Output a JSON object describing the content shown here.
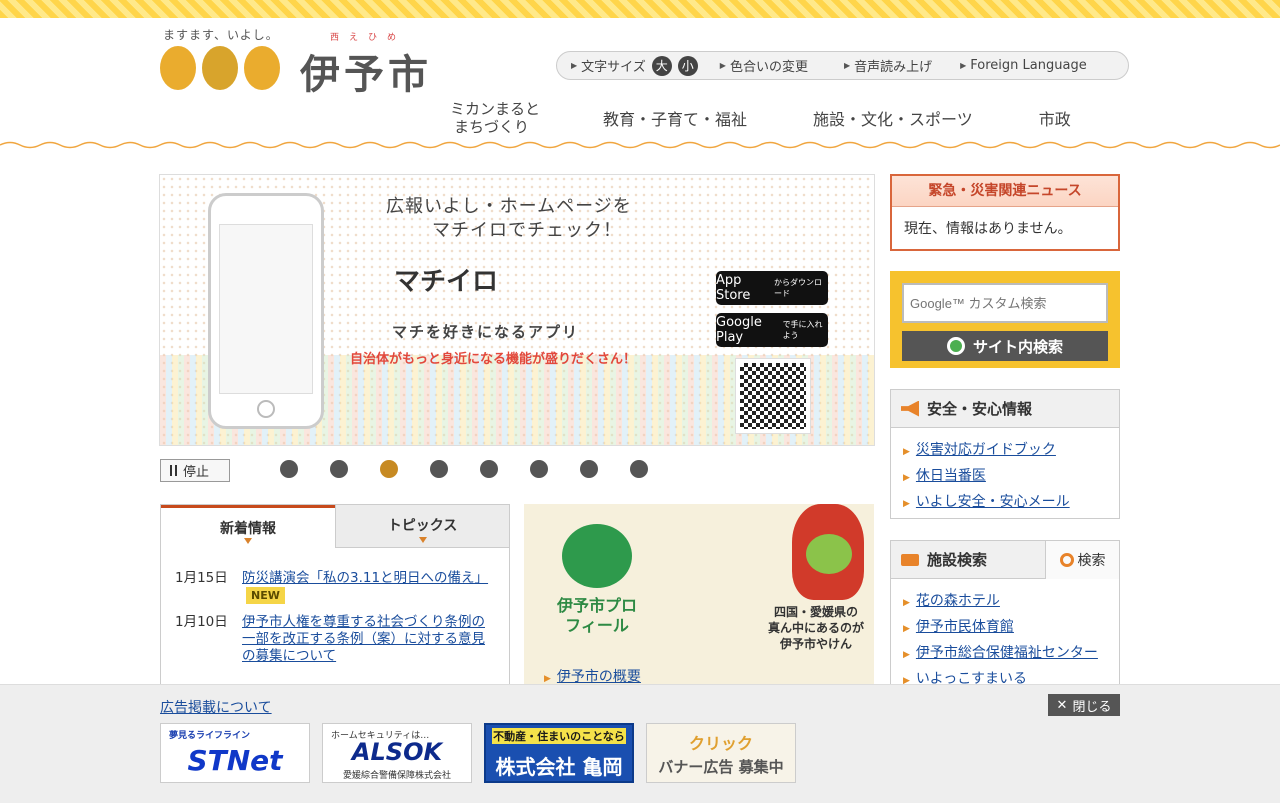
{
  "header": {
    "tagline": "ますます、いよし。",
    "logo_title": "伊予市",
    "logo_ruby": "西えひめ",
    "util": {
      "font_size_label": "文字サイズ",
      "font_large": "大",
      "font_small": "小",
      "color_change": "色合いの変更",
      "read_aloud": "音声読み上げ",
      "foreign_language": "Foreign Language"
    },
    "nav": {
      "item1_line1": "ミカンまると",
      "item1_line2": "まちづくり",
      "item2": "教育・子育て・福祉",
      "item3": "施設・文化・スポーツ",
      "item4": "市政"
    }
  },
  "slider": {
    "headline_line1": "広報いよし・ホームページを",
    "headline_line2": "マチイロでチェック！",
    "brand": "マチイロ",
    "tagline": "マチを好きになるアプリ",
    "subline": "自治体がもっと身近になる機能が盛りだくさん！",
    "app_store_label": "App Store",
    "app_store_sub": "からダウンロード",
    "google_play_label": "Google Play",
    "google_play_sub": "で手に入れよう",
    "pause_label": "停止",
    "page_count": 8,
    "active_page": 3
  },
  "news": {
    "tab_new": "新着情報",
    "tab_topics": "トピックス",
    "items": [
      {
        "date": "1月15日",
        "title": "防災講演会「私の3.11と明日への備え」",
        "badge": "NEW"
      },
      {
        "date": "1月10日",
        "title": "伊予市人権を尊重する社会づくり条例の一部を改正する条例（案）に対する意見の募集について",
        "badge": ""
      }
    ]
  },
  "profile": {
    "title": "伊予市プロフィール",
    "caption_line1": "四国・愛媛県の",
    "caption_line2": "真ん中にあるのが",
    "caption_line3": "伊予市やけん",
    "link": "伊予市の概要"
  },
  "emergency": {
    "title": "緊急・災害関連ニュース",
    "body": "現在、情報はありません。"
  },
  "search": {
    "placeholder": "Google™ カスタム検索",
    "button": "サイト内検索"
  },
  "safety": {
    "title": "安全・安心情報",
    "items": [
      "災害対応ガイドブック",
      "休日当番医",
      "いよし安全・安心メール"
    ]
  },
  "facility": {
    "title": "施設検索",
    "search_label": "検索",
    "items": [
      "花の森ホテル",
      "伊予市民体育館",
      "伊予市総合保健福祉センター",
      "いよっこすまいる"
    ]
  },
  "ads": {
    "link": "広告掲載について",
    "close": "閉じる",
    "stnet_small": "夢見るライフライン",
    "stnet_big": "STNet",
    "alsok_small": "ホームセキュリティは…",
    "alsok_big": "ALSOK",
    "alsok_sub": "愛媛綜合警備保障株式会社",
    "kameoka_small": "不動産・住まいのことなら",
    "kameoka_big": "株式会社 亀岡",
    "recruit_line1": "クリック",
    "recruit_line2": "バナー広告 募集中"
  },
  "colors": {
    "accent_orange": "#e8832a",
    "emergency_red": "#d9663b",
    "search_yellow": "#f6c22e",
    "link_blue": "#1a4d9c"
  }
}
